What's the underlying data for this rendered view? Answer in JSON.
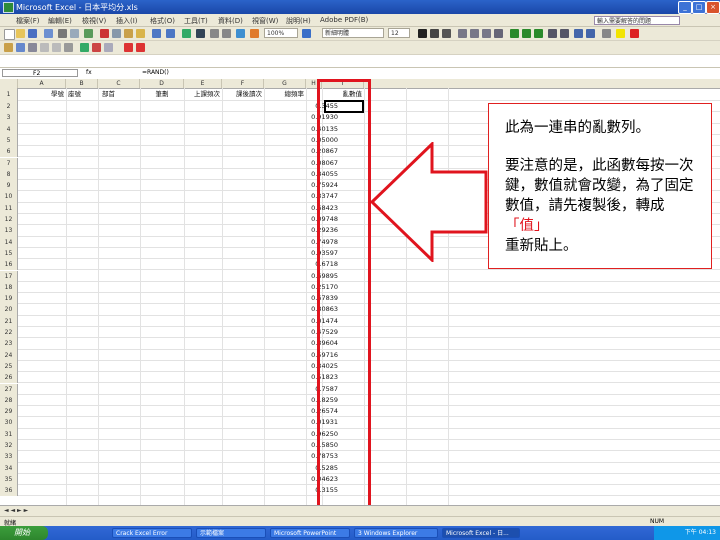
{
  "window": {
    "title": "Microsoft Excel - 日本平均分.xls"
  },
  "menu": [
    "檔案(F)",
    "編輯(E)",
    "檢視(V)",
    "插入(I)",
    "格式(O)",
    "工具(T)",
    "資料(D)",
    "視窗(W)",
    "說明(H)",
    "Adobe PDF(B)"
  ],
  "help_placeholder": "輸入需要解答的問題",
  "toolbar": {
    "zoom": "100%",
    "font": "新細明體",
    "font_size": "12"
  },
  "formula_bar": {
    "name_box": "F2",
    "fx": "fx",
    "formula": "=RAND()"
  },
  "columns": [
    "A",
    "B",
    "C",
    "D",
    "E",
    "F",
    "G",
    "H",
    "I"
  ],
  "header_row": {
    "a": "學號",
    "b": "座號",
    "c": "部首",
    "d": "筆劃",
    "e": "上課頻次",
    "f": "課後讀次",
    "g": "總頻率",
    "h": "亂數值"
  },
  "rows": [
    [
      "2",
      "",
      "",
      "",
      "",
      "",
      "",
      "",
      "0.3455"
    ],
    [
      "3",
      "",
      "",
      "",
      "",
      "",
      "",
      "",
      "0.91930"
    ],
    [
      "4",
      "",
      "",
      "",
      "",
      "",
      "",
      "",
      "0.40135"
    ],
    [
      "5",
      "",
      "",
      "",
      "",
      "",
      "",
      "",
      "0.05000"
    ],
    [
      "6",
      "",
      "",
      "",
      "",
      "",
      "",
      "",
      "0.20867"
    ],
    [
      "7",
      "",
      "",
      "",
      "",
      "",
      "",
      "",
      "0.08067"
    ],
    [
      "8",
      "",
      "",
      "",
      "",
      "",
      "",
      "",
      "0.84055"
    ],
    [
      "9",
      "",
      "",
      "",
      "",
      "",
      "",
      "",
      "0.75924"
    ],
    [
      "10",
      "",
      "",
      "",
      "",
      "",
      "",
      "",
      "0.33747"
    ],
    [
      "11",
      "",
      "",
      "",
      "",
      "",
      "",
      "",
      "0.68423"
    ],
    [
      "12",
      "",
      "",
      "",
      "",
      "",
      "",
      "",
      "0.09748"
    ],
    [
      "13",
      "",
      "",
      "",
      "",
      "",
      "",
      "",
      "0.29236"
    ],
    [
      "14",
      "",
      "",
      "",
      "",
      "",
      "",
      "",
      "0.74978"
    ],
    [
      "15",
      "",
      "",
      "",
      "",
      "",
      "",
      "",
      "0.93597"
    ],
    [
      "16",
      "",
      "",
      "",
      "",
      "",
      "",
      "",
      "0.6718"
    ],
    [
      "17",
      "",
      "",
      "",
      "",
      "",
      "",
      "",
      "0.69895"
    ],
    [
      "18",
      "",
      "",
      "",
      "",
      "",
      "",
      "",
      "0.25170"
    ],
    [
      "19",
      "",
      "",
      "",
      "",
      "",
      "",
      "",
      "0.67839"
    ],
    [
      "20",
      "",
      "",
      "",
      "",
      "",
      "",
      "",
      "0.80863"
    ],
    [
      "21",
      "",
      "",
      "",
      "",
      "",
      "",
      "",
      "0.01474"
    ],
    [
      "22",
      "",
      "",
      "",
      "",
      "",
      "",
      "",
      "0.47529"
    ],
    [
      "23",
      "",
      "",
      "",
      "",
      "",
      "",
      "",
      "0.39604"
    ],
    [
      "24",
      "",
      "",
      "",
      "",
      "",
      "",
      "",
      "0.59716"
    ],
    [
      "25",
      "",
      "",
      "",
      "",
      "",
      "",
      "",
      "0.34025"
    ],
    [
      "26",
      "",
      "",
      "",
      "",
      "",
      "",
      "",
      "0.51823"
    ],
    [
      "27",
      "",
      "",
      "",
      "",
      "",
      "",
      "",
      "0.7587"
    ],
    [
      "28",
      "",
      "",
      "",
      "",
      "",
      "",
      "",
      "0.18259"
    ],
    [
      "29",
      "",
      "",
      "",
      "",
      "",
      "",
      "",
      "0.26574"
    ],
    [
      "30",
      "",
      "",
      "",
      "",
      "",
      "",
      "",
      "0.01931"
    ],
    [
      "31",
      "",
      "",
      "",
      "",
      "",
      "",
      "",
      "0.96250"
    ],
    [
      "32",
      "",
      "",
      "",
      "",
      "",
      "",
      "",
      "0.15850"
    ],
    [
      "33",
      "",
      "",
      "",
      "",
      "",
      "",
      "",
      "0.78753"
    ],
    [
      "34",
      "",
      "",
      "",
      "",
      "",
      "",
      "",
      "0.5285"
    ],
    [
      "35",
      "",
      "",
      "",
      "",
      "",
      "",
      "",
      "0.04623"
    ],
    [
      "36",
      "",
      "",
      "",
      "",
      "",
      "",
      "",
      "0.3155"
    ]
  ],
  "callout": {
    "line1": "此為一連串的亂數列。",
    "line2a": "要注意的是，此函數每按一次鍵，數值就會改變，為了固定數值，請先複製後，轉成",
    "line2_highlight": "「值」",
    "line2b": "重新貼上。"
  },
  "status": {
    "left": "就緒",
    "right": "NUM"
  },
  "taskbar": {
    "start": "開始",
    "tasks": [
      "Crack Excel Error",
      "示範檔案",
      "Microsoft PowerPoint",
      "3 Windows Explorer",
      "Microsoft Excel - 日..."
    ],
    "clock": "下午 04:13"
  },
  "colors": {
    "highlight_red": "#e0141e",
    "title_blue": "#1a47a8"
  }
}
